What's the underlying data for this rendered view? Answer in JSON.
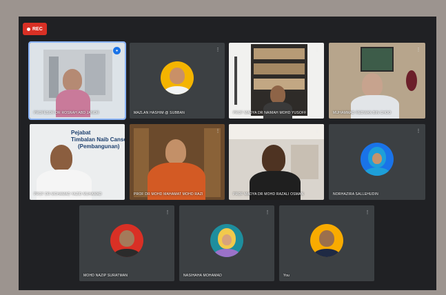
{
  "recording": {
    "label": "REC"
  },
  "participants": [
    {
      "name": "PROFESOR DR ROSNAH ABD JANOR",
      "active_speaker": true
    },
    {
      "name": "MAZLAN HASHIM @ SUBBAN",
      "avatar_color": "#f4b400",
      "active_speaker": false
    },
    {
      "name": "PROF MADYA DR NAIMAH MOHD YUSOFF",
      "active_speaker": false
    },
    {
      "name": "MUHAMMAD REDWAN BIN CHOO",
      "active_speaker": false
    },
    {
      "name": "PROF DR MOHAMAD YAZID MUHAMAD",
      "caption_banner": [
        "Pejabat",
        "Timbalan Naib Canselor",
        "(Pembangunan)"
      ],
      "active_speaker": false
    },
    {
      "name": "PROF DR MOHD MAHAMAT MOHD RAZI",
      "active_speaker": false
    },
    {
      "name": "PROF MADYA DR MOHD RAZALI OSMAN",
      "active_speaker": false
    },
    {
      "name": "NORHAZIRA SALLEHUDIN",
      "avatar_color": "#1a73e8",
      "active_speaker": false
    },
    {
      "name": "MOHD NAZIP SURATMAN",
      "avatar_color": "#d93025",
      "active_speaker": false
    },
    {
      "name": "NASIHAHA MOHAMAD",
      "avatar_color": "#1e8e9e",
      "active_speaker": false
    },
    {
      "name": "You",
      "avatar_color": "#f9ab00",
      "active_speaker": false
    }
  ]
}
